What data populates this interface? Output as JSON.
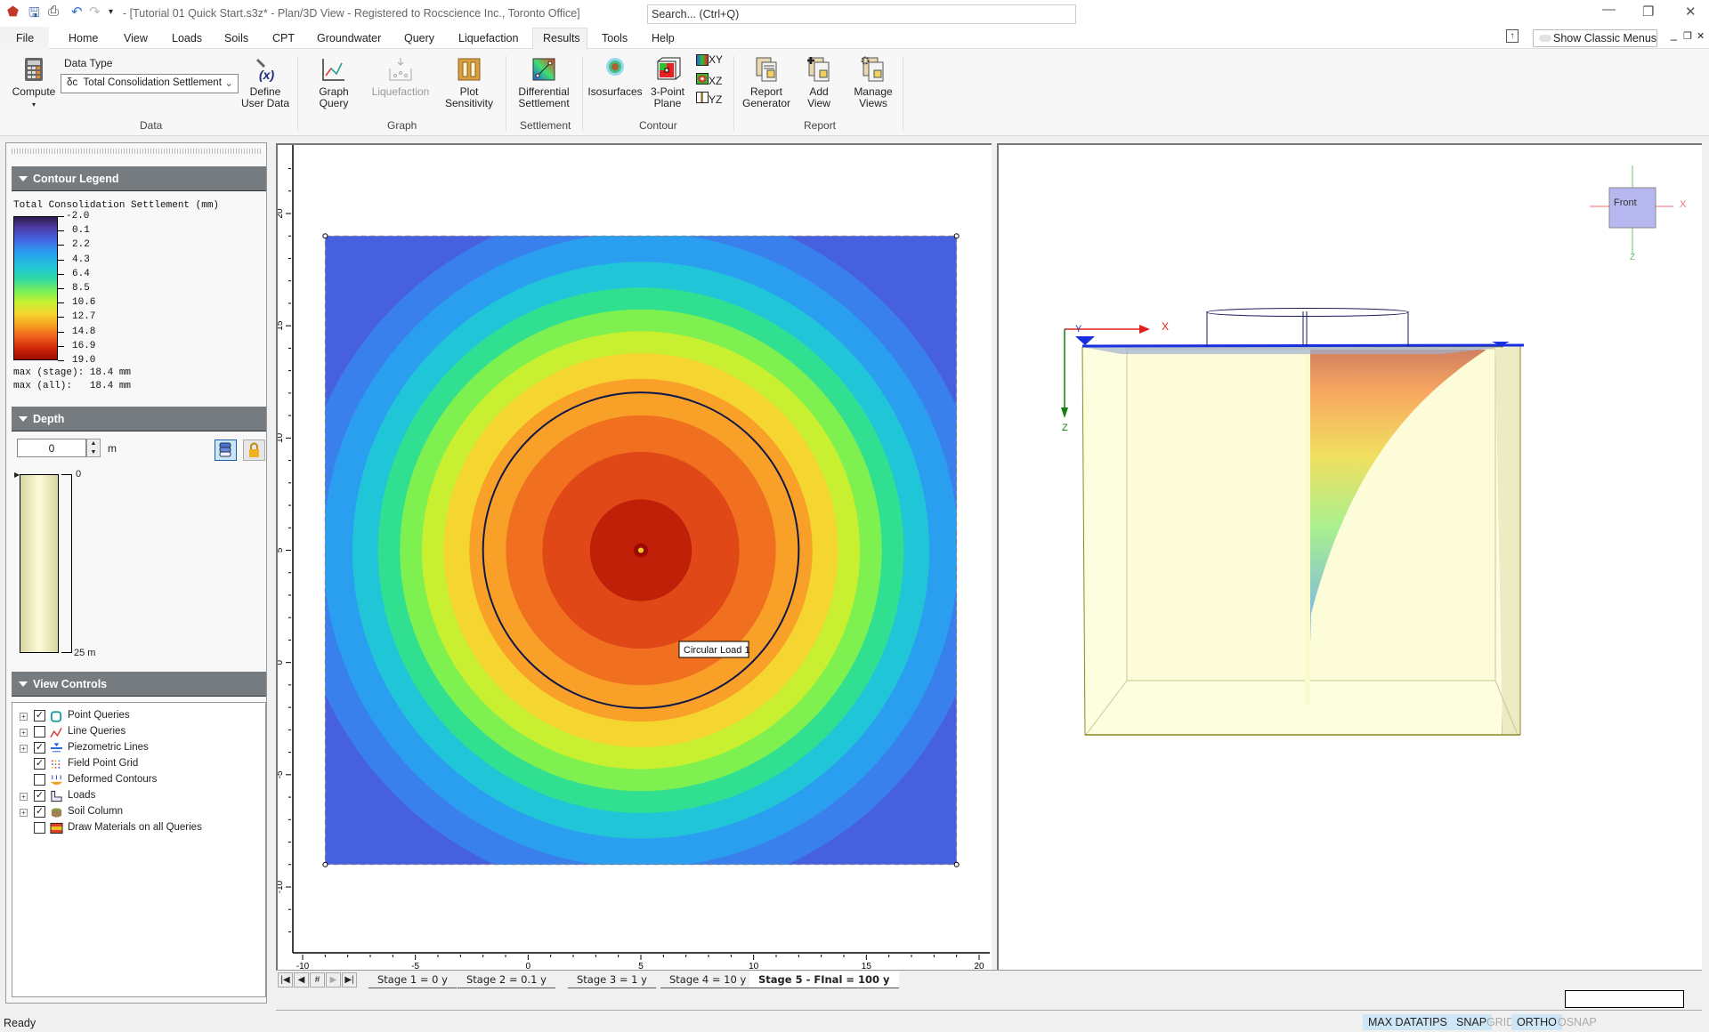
{
  "window": {
    "title": "- [Tutorial 01 Quick Start.s3z* - Plan/3D View - Registered to Rocscience Inc., Toronto Office]",
    "search_placeholder": "Search... (Ctrl+Q)",
    "show_classic_menus": "Show Classic Menus"
  },
  "menu": {
    "file": "File",
    "tabs": [
      "Home",
      "View",
      "Loads",
      "Soils",
      "CPT",
      "Groundwater",
      "Query",
      "Liquefaction",
      "Results",
      "Tools",
      "Help"
    ],
    "active_tab": "Results"
  },
  "ribbon": {
    "compute": "Compute",
    "data_type_label": "Data Type",
    "data_type_symbol": "δc",
    "data_type_value": "Total Consolidation Settlement",
    "define_user_data_1": "Define",
    "define_user_data_2": "User Data",
    "graph_query_1": "Graph",
    "graph_query_2": "Query",
    "liquefaction": "Liquefaction",
    "plot_sensitivity_1": "Plot",
    "plot_sensitivity_2": "Sensitivity",
    "differential_settlement_1": "Differential",
    "differential_settlement_2": "Settlement",
    "isosurfaces": "Isosurfaces",
    "three_point_plane_1": "3-Point",
    "three_point_plane_2": "Plane",
    "plane_xy": "XY",
    "plane_xz": "XZ",
    "plane_yz": "YZ",
    "report_generator_1": "Report",
    "report_generator_2": "Generator",
    "add_view_1": "Add",
    "add_view_2": "View",
    "manage_views_1": "Manage",
    "manage_views_2": "Views",
    "groups": {
      "data": "Data",
      "graph": "Graph",
      "settlement": "Settlement",
      "contour": "Contour",
      "report": "Report"
    }
  },
  "contour_legend": {
    "header": "Contour Legend",
    "title": "Total Consolidation Settlement (mm)",
    "levels": [
      "-2.0",
      "0.1",
      "2.2",
      "4.3",
      "6.4",
      "8.5",
      "10.6",
      "12.7",
      "14.8",
      "16.9",
      "19.0"
    ],
    "max_stage": "max (stage): 18.4 mm",
    "max_all": "max (all):   18.4 mm"
  },
  "depth": {
    "header": "Depth",
    "value": "0",
    "unit": "m",
    "top_label": "0",
    "bottom_label": "25 m"
  },
  "view_controls": {
    "header": "View Controls",
    "items": [
      {
        "label": "Point Queries",
        "checked": true,
        "expandable": true
      },
      {
        "label": "Line Queries",
        "checked": false,
        "expandable": true
      },
      {
        "label": "Piezometric Lines",
        "checked": true,
        "expandable": true
      },
      {
        "label": "Field Point Grid",
        "checked": true,
        "expandable": false
      },
      {
        "label": "Deformed Contours",
        "checked": false,
        "expandable": false
      },
      {
        "label": "Loads",
        "checked": true,
        "expandable": true
      },
      {
        "label": "Soil Column",
        "checked": true,
        "expandable": true
      },
      {
        "label": "Draw Materials on all Queries",
        "checked": false,
        "expandable": false
      }
    ]
  },
  "plan_view": {
    "x_ticks": [
      "-10",
      "-5",
      "0",
      "5",
      "10",
      "15",
      "20"
    ],
    "y_ticks": [
      "20",
      "15",
      "10",
      "5",
      "0",
      "-5",
      "-10"
    ],
    "load_label": "Circular Load 1",
    "x_range": [
      -10.5,
      20.5
    ],
    "y_range": [
      -13,
      23
    ],
    "grid_extent": [
      -9,
      19
    ],
    "load_center": [
      5,
      5
    ],
    "load_radius": 7,
    "max_value_mm": 18.4
  },
  "view_3d": {
    "cube_label": "Front",
    "axis_x": "X",
    "axis_y": "Y",
    "axis_z": "Z"
  },
  "stages": {
    "nav": [
      "|◀",
      "◀",
      "#",
      "▶",
      "▶|"
    ],
    "tabs": [
      "Stage 1 = 0 y",
      "Stage 2 = 0.1 y",
      "Stage 3 = 1 y",
      "Stage 4 = 10 y",
      "Stage 5 - FInal = 100 y"
    ],
    "active": 4
  },
  "status": {
    "ready": "Ready",
    "indicators": [
      {
        "label": "MAX DATATIPS",
        "on": true
      },
      {
        "label": "SNAP",
        "on": true
      },
      {
        "label": "GRID",
        "on": false
      },
      {
        "label": "ORTHO",
        "on": true
      },
      {
        "label": "OSNAP",
        "on": false
      }
    ]
  }
}
